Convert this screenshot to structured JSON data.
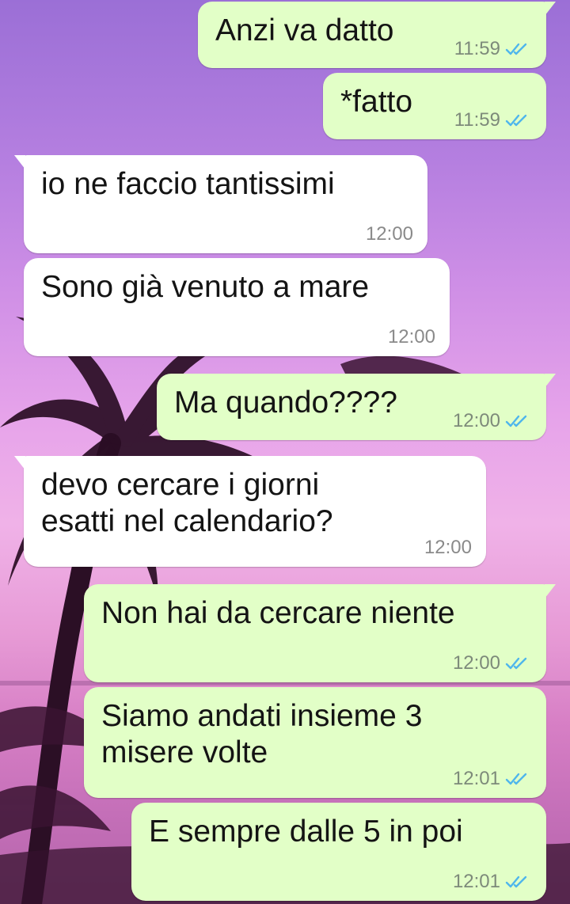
{
  "messages": [
    {
      "dir": "out",
      "text": "Anzi va datto",
      "time": "11:59",
      "status": "read"
    },
    {
      "dir": "out",
      "text": "*fatto",
      "time": "11:59",
      "status": "read"
    },
    {
      "dir": "in",
      "text": "io ne faccio tantissimi",
      "time": "12:00"
    },
    {
      "dir": "in",
      "text": "Sono già venuto a mare",
      "time": "12:00"
    },
    {
      "dir": "out",
      "text": "Ma quando????",
      "time": "12:00",
      "status": "read"
    },
    {
      "dir": "in",
      "text": "devo cercare i giorni\nesatti nel calendario?",
      "time": "12:00"
    },
    {
      "dir": "out",
      "text": "Non hai da cercare niente",
      "time": "12:00",
      "status": "read"
    },
    {
      "dir": "out",
      "text": "Siamo andati insieme 3\nmisere volte",
      "time": "12:01",
      "status": "read"
    },
    {
      "dir": "out",
      "text": "E sempre dalle 5 in poi",
      "time": "12:01",
      "status": "read"
    }
  ],
  "colors": {
    "outgoing_bubble": "#e2ffc7",
    "incoming_bubble": "#ffffff",
    "read_ticks": "#4fb6ec"
  },
  "icons": {
    "read_receipt": "double-check-icon"
  }
}
